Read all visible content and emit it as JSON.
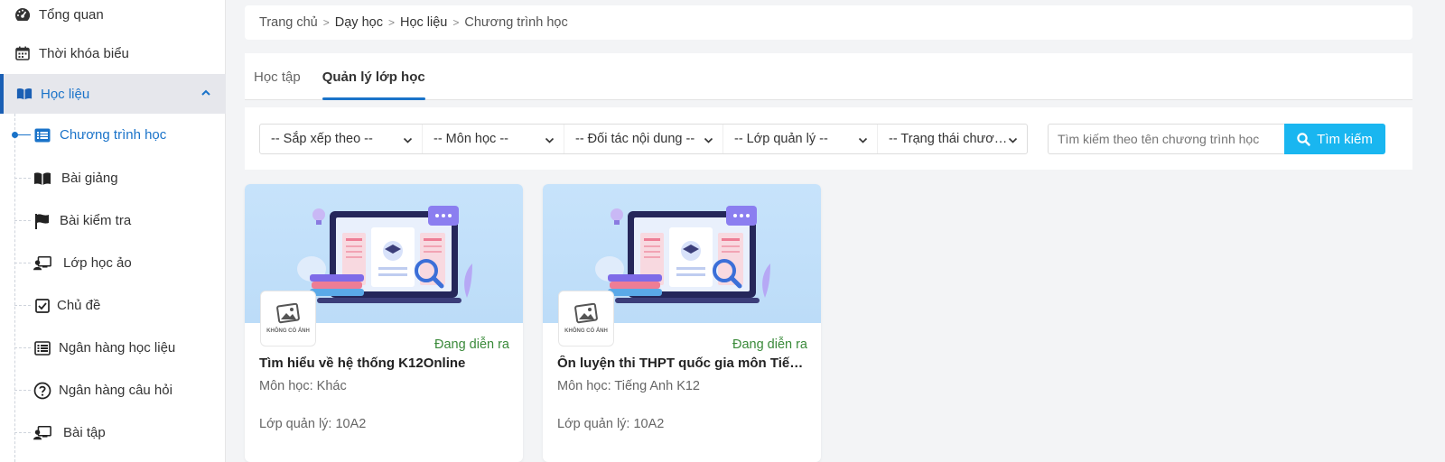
{
  "sidebar": {
    "top_items": [
      {
        "label": "Tổng quan",
        "icon": "dashboard-icon"
      },
      {
        "label": "Thời khóa biểu",
        "icon": "calendar-icon"
      }
    ],
    "active_section": {
      "label": "Học liệu",
      "icon": "book-open-icon"
    },
    "sub_items": [
      {
        "label": "Chương trình học",
        "icon": "list-icon",
        "active": true
      },
      {
        "label": "Bài giảng",
        "icon": "book-icon"
      },
      {
        "label": "Bài kiểm tra",
        "icon": "flag-icon"
      },
      {
        "label": "Lớp học ảo",
        "icon": "virtual-class-icon"
      },
      {
        "label": "Chủ đề",
        "icon": "checkbox-icon"
      },
      {
        "label": "Ngân hàng học liệu",
        "icon": "list-icon"
      },
      {
        "label": "Ngân hàng câu hỏi",
        "icon": "question-circle-icon"
      },
      {
        "label": "Bài tập",
        "icon": "virtual-class-icon"
      }
    ]
  },
  "breadcrumb": [
    "Trang chủ",
    "Dạy học",
    "Học liệu",
    "Chương trình học"
  ],
  "tabs": [
    {
      "label": "Học tập",
      "active": false
    },
    {
      "label": "Quản lý lớp học",
      "active": true
    }
  ],
  "filters": {
    "selects": [
      "-- Sắp xếp theo --",
      "-- Môn học --",
      "-- Đối tác nội dung --",
      "-- Lớp quản lý --",
      "-- Trạng thái chươ…"
    ],
    "search_placeholder": "Tìm kiếm theo tên chương trình học",
    "search_button": "Tìm kiếm"
  },
  "cards": [
    {
      "thumb_text": "KHÔNG CÓ ẢNH",
      "status": "Đang diễn ra",
      "title": "Tìm hiểu về hệ thống K12Online",
      "subject": "Môn học: Khác",
      "class": "Lớp quản lý: 10A2"
    },
    {
      "thumb_text": "KHÔNG CÓ ẢNH",
      "status": "Đang diễn ra",
      "title": "Ôn luyện thi THPT quốc gia môn Tiến…",
      "subject": "Môn học: Tiếng Anh K12",
      "class": "Lớp quản lý: 10A2"
    }
  ],
  "colors": {
    "accent": "#1a73c9",
    "search_button": "#19b6f0",
    "status_green": "#3a8a3a"
  }
}
